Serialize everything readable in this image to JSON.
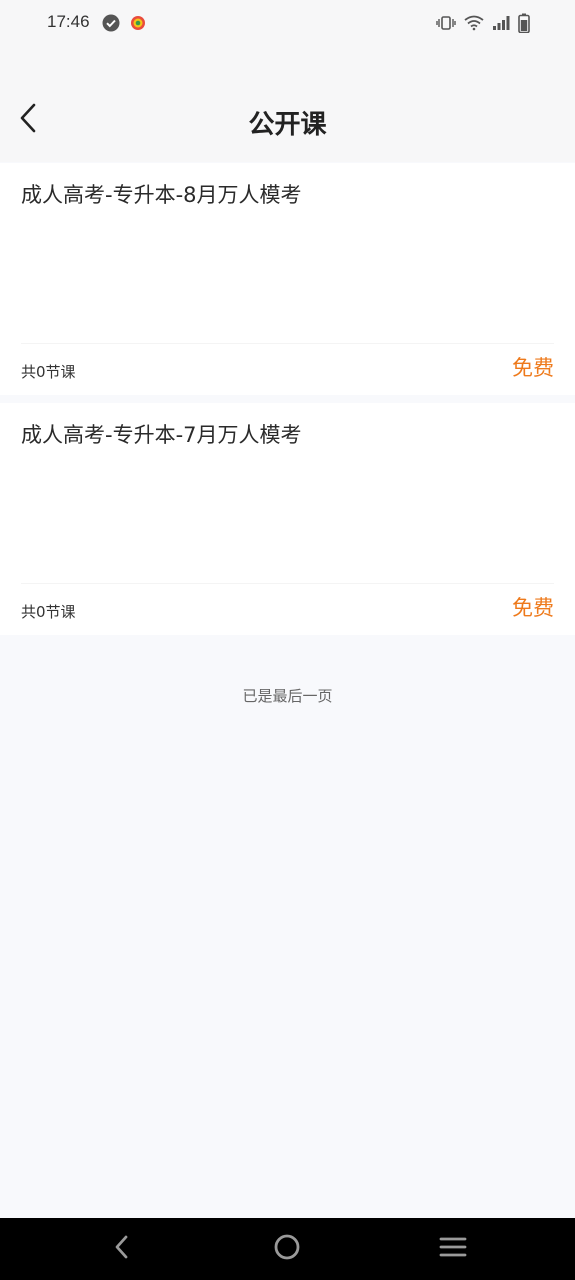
{
  "status_bar": {
    "time": "17:46"
  },
  "header": {
    "title": "公开课"
  },
  "courses": [
    {
      "title": "成人高考-专升本-8月万人模考",
      "lesson_count": "共0节课",
      "price": "免费"
    },
    {
      "title": "成人高考-专升本-7月万人模考",
      "lesson_count": "共0节课",
      "price": "免费"
    }
  ],
  "footer": {
    "end_text": "已是最后一页"
  },
  "colors": {
    "accent": "#ee7a1c",
    "background": "#f8f9fc",
    "card": "#ffffff"
  }
}
